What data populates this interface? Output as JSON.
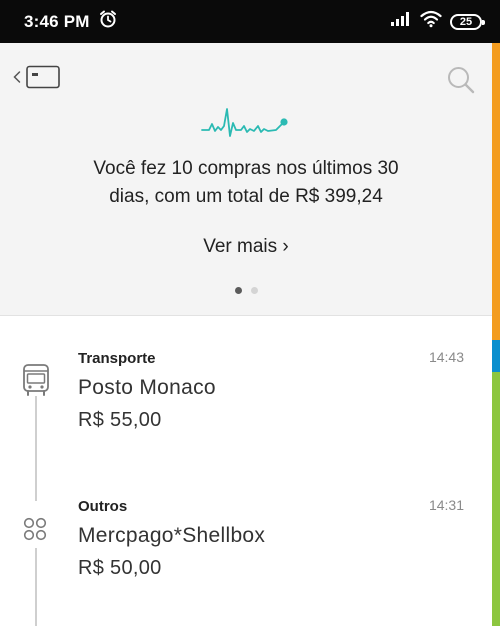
{
  "status_bar": {
    "time": "3:46 PM",
    "battery": "25",
    "icons": [
      "alarm-icon",
      "signal-icon",
      "wifi-icon",
      "battery-icon"
    ]
  },
  "colors": {
    "accent": "#2bbab3",
    "strip_orange": "#f39c1f",
    "strip_blue": "#0a8fce",
    "strip_green": "#8cc63f"
  },
  "header": {
    "back_icon": "chevron-left-icon",
    "card_icon": "card-icon",
    "search_icon": "search-icon",
    "chart_icon": "pulse-chart-icon",
    "summary_line1": "Você fez 10 compras nos últimos 30",
    "summary_line2": "dias, com um total de R$ 399,24",
    "see_more": "Ver mais ›",
    "pager_total": 2,
    "pager_active": 1
  },
  "transactions": [
    {
      "category": "Transporte",
      "merchant": "Posto Monaco",
      "amount": "R$ 55,00",
      "time": "14:43",
      "icon": "bus-icon"
    },
    {
      "category": "Outros",
      "merchant": "Mercpago*Shellbox",
      "amount": "R$ 50,00",
      "time": "14:31",
      "icon": "four-circles-icon"
    }
  ]
}
